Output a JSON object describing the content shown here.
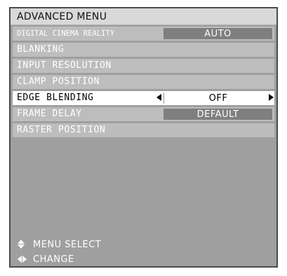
{
  "menu": {
    "title": "ADVANCED MENU",
    "items": [
      {
        "label": "DIGITAL CINEMA REALITY",
        "value": "AUTO"
      },
      {
        "label": "BLANKING"
      },
      {
        "label": "INPUT RESOLUTION"
      },
      {
        "label": "CLAMP POSITION"
      },
      {
        "label": "EDGE BLENDING",
        "value": "OFF"
      },
      {
        "label": "FRAME DELAY",
        "value": "DEFAULT"
      },
      {
        "label": "RASTER POSITION"
      }
    ]
  },
  "footer": {
    "select_hint": "MENU SELECT",
    "change_hint": "CHANGE"
  },
  "icons": {
    "select": "up-down-arrows-icon",
    "change": "left-right-arrows-icon"
  },
  "colors": {
    "menu_background": "#9f9f9f",
    "row_background": "#bdbdbd",
    "value_background": "#7f7f7f",
    "selected_background": "#ffffff",
    "title_background": "#d9d9d9"
  }
}
